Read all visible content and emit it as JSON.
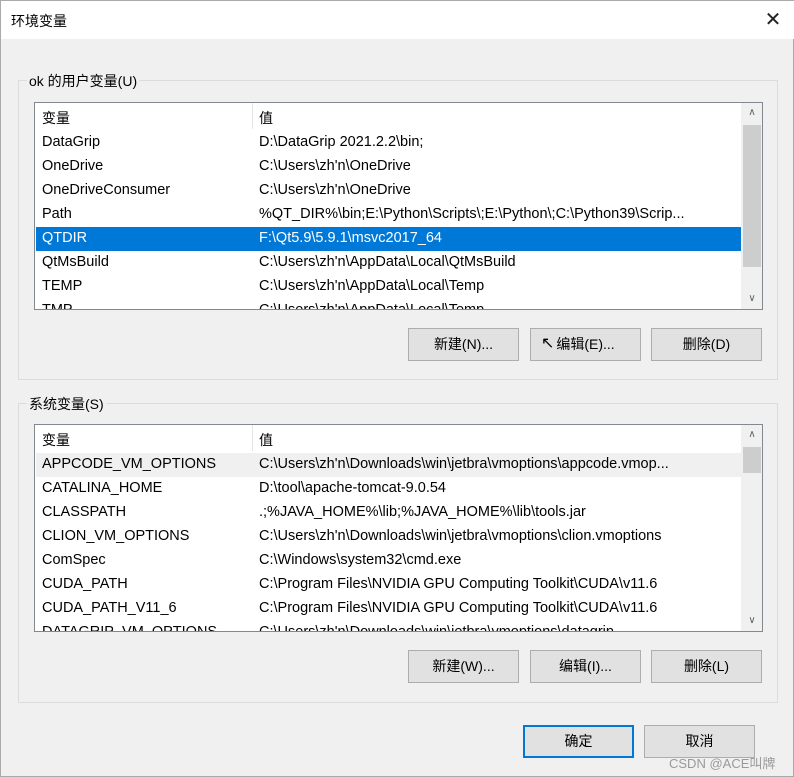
{
  "window": {
    "title": "环境变量",
    "close_icon": "close-icon"
  },
  "user_vars": {
    "label": "ok 的用户变量(U)",
    "columns": [
      "变量",
      "值"
    ],
    "rows": [
      {
        "name": "DataGrip",
        "value": "D:\\DataGrip 2021.2.2\\bin;"
      },
      {
        "name": "OneDrive",
        "value": "C:\\Users\\zh'n\\OneDrive"
      },
      {
        "name": "OneDriveConsumer",
        "value": "C:\\Users\\zh'n\\OneDrive"
      },
      {
        "name": "Path",
        "value": "%QT_DIR%\\bin;E:\\Python\\Scripts\\;E:\\Python\\;C:\\Python39\\Scrip..."
      },
      {
        "name": "QTDIR",
        "value": "F:\\Qt5.9\\5.9.1\\msvc2017_64",
        "selected": true
      },
      {
        "name": "QtMsBuild",
        "value": "C:\\Users\\zh'n\\AppData\\Local\\QtMsBuild"
      },
      {
        "name": "TEMP",
        "value": "C:\\Users\\zh'n\\AppData\\Local\\Temp"
      },
      {
        "name": "TMP",
        "value": "C:\\Users\\zh'n\\AppData\\Local\\Temp"
      }
    ],
    "buttons": {
      "new": "新建(N)...",
      "edit": "编辑(E)...",
      "delete": "删除(D)"
    }
  },
  "system_vars": {
    "label": "系统变量(S)",
    "columns": [
      "变量",
      "值"
    ],
    "rows": [
      {
        "name": "APPCODE_VM_OPTIONS",
        "value": "C:\\Users\\zh'n\\Downloads\\win\\jetbra\\vmoptions\\appcode.vmop..."
      },
      {
        "name": "CATALINA_HOME",
        "value": "D:\\tool\\apache-tomcat-9.0.54"
      },
      {
        "name": "CLASSPATH",
        "value": ".;%JAVA_HOME%\\lib;%JAVA_HOME%\\lib\\tools.jar"
      },
      {
        "name": "CLION_VM_OPTIONS",
        "value": "C:\\Users\\zh'n\\Downloads\\win\\jetbra\\vmoptions\\clion.vmoptions"
      },
      {
        "name": "ComSpec",
        "value": "C:\\Windows\\system32\\cmd.exe"
      },
      {
        "name": "CUDA_PATH",
        "value": "C:\\Program Files\\NVIDIA GPU Computing Toolkit\\CUDA\\v11.6"
      },
      {
        "name": "CUDA_PATH_V11_6",
        "value": "C:\\Program Files\\NVIDIA GPU Computing Toolkit\\CUDA\\v11.6"
      },
      {
        "name": "DATAGRIP_VM_OPTIONS",
        "value": "C:\\Users\\zh'n\\Downloads\\win\\jetbra\\vmoptions\\datagrip"
      }
    ],
    "buttons": {
      "new": "新建(W)...",
      "edit": "编辑(I)...",
      "delete": "删除(L)"
    }
  },
  "footer": {
    "ok": "确定",
    "cancel": "取消"
  },
  "watermark": "CSDN @ACE叫牌",
  "colors": {
    "selection": "#0078d7",
    "background": "#f0f0f0"
  }
}
